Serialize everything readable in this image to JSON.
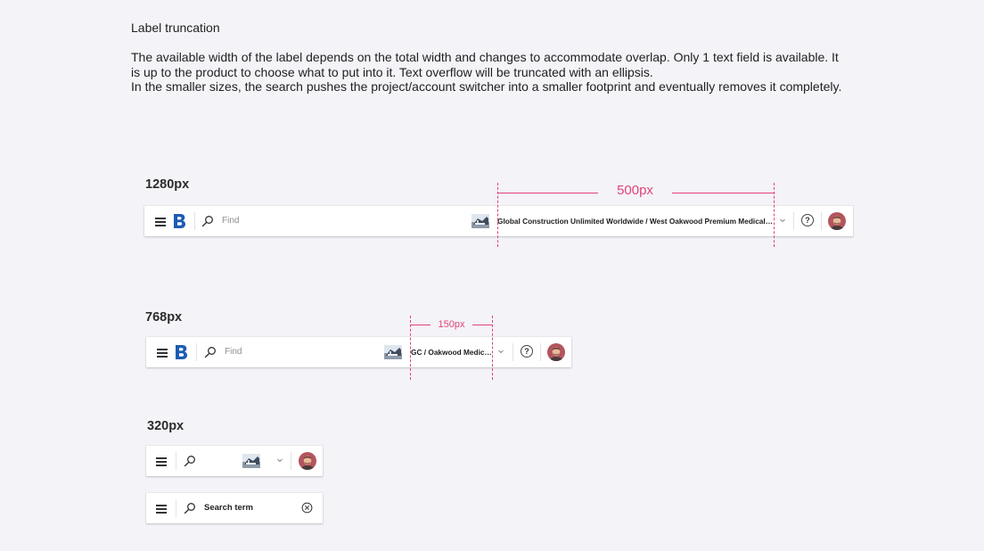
{
  "heading": "Label truncation",
  "description": [
    "The available width of the label depends on the total width and changes to accommodate overlap. Only 1 text field is available. It is up to the product to choose what to put into it. Text overflow will be truncated with an ellipsis.",
    "In the smaller sizes, the search pushes the project/account switcher into a smaller footprint and eventually removes it completely."
  ],
  "sizes": {
    "large": "1280px",
    "medium": "768px",
    "small": "320px"
  },
  "dimensions": {
    "large": "500px",
    "medium": "150px"
  },
  "search": {
    "placeholder": "Find",
    "search_term": "Search term"
  },
  "project": {
    "label_full": "Global Construction Unlimited Worldwide / West Oakwood Premium Medical Center",
    "label_short": "GC / Oakwood Medical Center"
  },
  "help_glyph": "?",
  "colors": {
    "accent": "#e0447a",
    "brand": "#1d5cb4",
    "background": "#f4f3f7"
  },
  "icons": [
    "menu-icon",
    "brand-logo-icon",
    "search-icon",
    "project-thumbnail",
    "chevron-down-icon",
    "help-icon",
    "avatar",
    "clear-icon"
  ]
}
